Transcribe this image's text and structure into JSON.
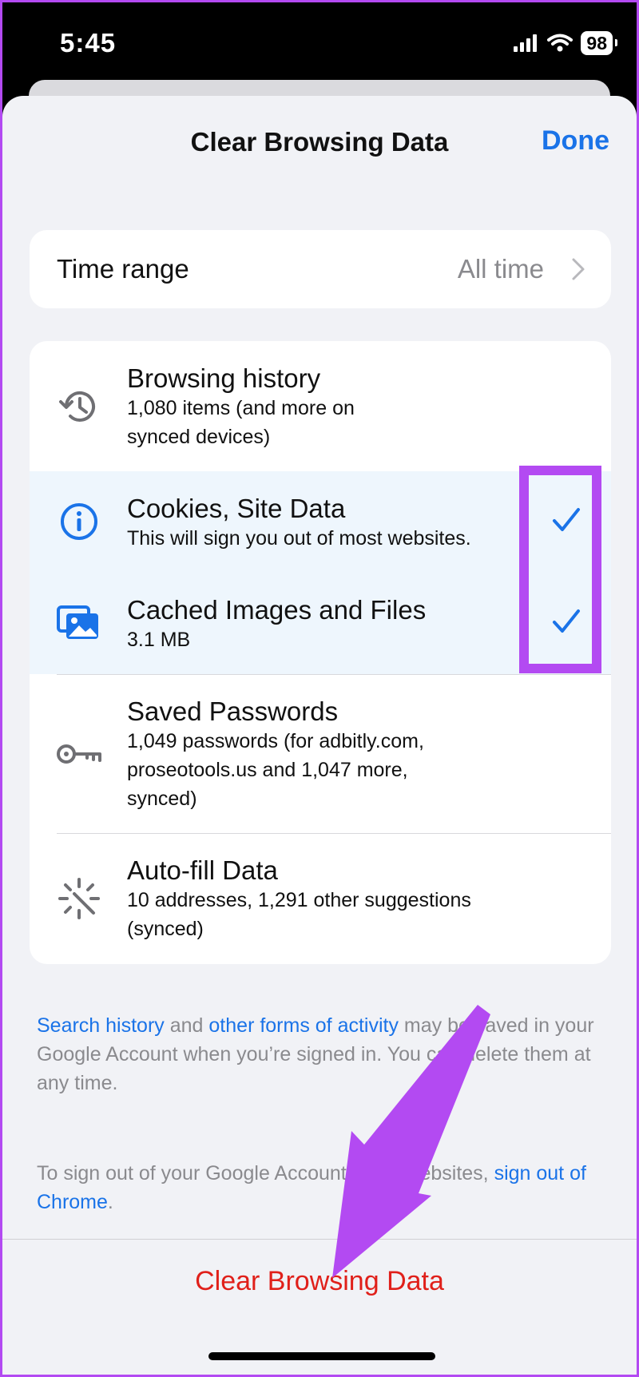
{
  "status": {
    "time": "5:45",
    "battery": "98"
  },
  "nav": {
    "title": "Clear Browsing Data",
    "done_label": "Done"
  },
  "time_range": {
    "label": "Time range",
    "value": "All time"
  },
  "items": [
    {
      "title": "Browsing history",
      "subtitle": "1,080 items (and more on synced devices)",
      "icon": "history-icon",
      "checked": false
    },
    {
      "title": "Cookies, Site Data",
      "subtitle": "This will sign you out of most websites.",
      "icon": "info-icon",
      "checked": true
    },
    {
      "title": "Cached Images and Files",
      "subtitle": "3.1 MB",
      "icon": "images-icon",
      "checked": true
    },
    {
      "title": "Saved Passwords",
      "subtitle": "1,049 passwords (for adbitly.com, proseotools.us and 1,047 more, synced)",
      "icon": "key-icon",
      "checked": false
    },
    {
      "title": "Auto-fill Data",
      "subtitle": "10 addresses, 1,291 other suggestions (synced)",
      "icon": "magic-wand-icon",
      "checked": false
    }
  ],
  "footer": {
    "note1_link1": "Search history",
    "note1_mid": " and ",
    "note1_link2": "other forms of activity",
    "note1_rest": " may be saved in your Google Account when you’re signed in. You can delete them at any time.",
    "note2_text": "To sign out of your Google Account on all websites, ",
    "note2_link": "sign out of Chrome",
    "note2_end": "."
  },
  "clear_button": "Clear Browsing Data",
  "colors": {
    "accent": "#1a73e8",
    "destructive": "#e0201a",
    "annotation": "#b34af2"
  }
}
